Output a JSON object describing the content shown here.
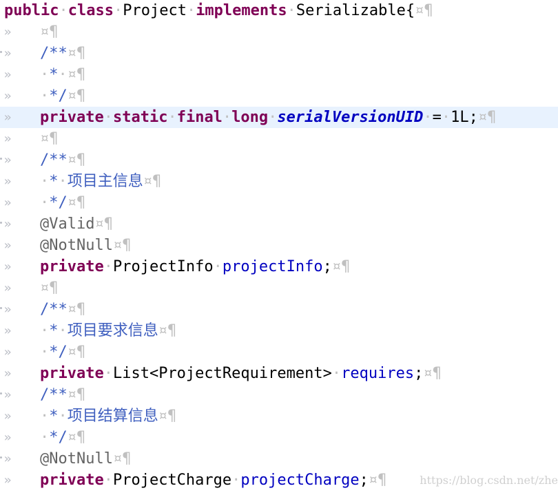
{
  "editor": {
    "lines": [
      {
        "gutter": "",
        "fold": false,
        "indent": false,
        "highlight": false,
        "tokens": [
          [
            "kw",
            "public"
          ],
          [
            "ws",
            "·"
          ],
          [
            "kw",
            "class"
          ],
          [
            "ws",
            "·"
          ],
          [
            "plain",
            "Project"
          ],
          [
            "ws",
            "·"
          ],
          [
            "kw",
            "implements"
          ],
          [
            "ws",
            "·"
          ],
          [
            "plain",
            "Serializable{"
          ],
          [
            "ws",
            "¤¶"
          ]
        ]
      },
      {
        "gutter": "»",
        "fold": false,
        "indent": true,
        "highlight": false,
        "tokens": [
          [
            "ws",
            "¤¶"
          ]
        ]
      },
      {
        "gutter": "»",
        "fold": true,
        "indent": true,
        "highlight": false,
        "tokens": [
          [
            "comment",
            "/**"
          ],
          [
            "ws",
            "¤¶"
          ]
        ]
      },
      {
        "gutter": "»",
        "fold": false,
        "indent": true,
        "highlight": false,
        "tokens": [
          [
            "ws",
            "·"
          ],
          [
            "comment",
            "*"
          ],
          [
            "ws",
            "·¤¶"
          ]
        ]
      },
      {
        "gutter": "»",
        "fold": false,
        "indent": true,
        "highlight": false,
        "tokens": [
          [
            "ws",
            "·"
          ],
          [
            "comment",
            "*/"
          ],
          [
            "ws",
            "¤¶"
          ]
        ]
      },
      {
        "gutter": "»",
        "fold": false,
        "indent": true,
        "highlight": true,
        "tokens": [
          [
            "kw",
            "private"
          ],
          [
            "ws",
            "·"
          ],
          [
            "kw",
            "static"
          ],
          [
            "ws",
            "·"
          ],
          [
            "kw",
            "final"
          ],
          [
            "ws",
            "·"
          ],
          [
            "kw",
            "long"
          ],
          [
            "ws",
            "·"
          ],
          [
            "static-field",
            "serialVersionUID"
          ],
          [
            "ws",
            "·"
          ],
          [
            "plain",
            "="
          ],
          [
            "ws",
            "·"
          ],
          [
            "plain",
            "1L;"
          ],
          [
            "ws",
            "¤¶"
          ]
        ]
      },
      {
        "gutter": "»",
        "fold": false,
        "indent": true,
        "highlight": false,
        "tokens": [
          [
            "ws",
            "¤¶"
          ]
        ]
      },
      {
        "gutter": "»",
        "fold": true,
        "indent": true,
        "highlight": false,
        "tokens": [
          [
            "comment",
            "/**"
          ],
          [
            "ws",
            "¤¶"
          ]
        ]
      },
      {
        "gutter": "»",
        "fold": false,
        "indent": true,
        "highlight": false,
        "tokens": [
          [
            "ws",
            "·"
          ],
          [
            "comment",
            "*"
          ],
          [
            "ws",
            "·"
          ],
          [
            "comment cjk",
            "项目主信息"
          ],
          [
            "ws",
            "¤¶"
          ]
        ]
      },
      {
        "gutter": "»",
        "fold": false,
        "indent": true,
        "highlight": false,
        "tokens": [
          [
            "ws",
            "·"
          ],
          [
            "comment",
            "*/"
          ],
          [
            "ws",
            "¤¶"
          ]
        ]
      },
      {
        "gutter": "»",
        "fold": true,
        "indent": true,
        "highlight": false,
        "tokens": [
          [
            "annotation",
            "@Valid"
          ],
          [
            "ws",
            "¤¶"
          ]
        ]
      },
      {
        "gutter": "»",
        "fold": false,
        "indent": true,
        "highlight": false,
        "tokens": [
          [
            "annotation",
            "@NotNull"
          ],
          [
            "ws",
            "¤¶"
          ]
        ]
      },
      {
        "gutter": "»",
        "fold": false,
        "indent": true,
        "highlight": false,
        "tokens": [
          [
            "kw",
            "private"
          ],
          [
            "ws",
            "·"
          ],
          [
            "plain",
            "ProjectInfo"
          ],
          [
            "ws",
            "·"
          ],
          [
            "field",
            "projectInfo"
          ],
          [
            "plain",
            ";"
          ],
          [
            "ws",
            "¤¶"
          ]
        ]
      },
      {
        "gutter": "»",
        "fold": false,
        "indent": true,
        "highlight": false,
        "tokens": [
          [
            "ws",
            "¤¶"
          ]
        ]
      },
      {
        "gutter": "»",
        "fold": true,
        "indent": true,
        "highlight": false,
        "tokens": [
          [
            "comment",
            "/**"
          ],
          [
            "ws",
            "¤¶"
          ]
        ]
      },
      {
        "gutter": "»",
        "fold": false,
        "indent": true,
        "highlight": false,
        "tokens": [
          [
            "ws",
            "·"
          ],
          [
            "comment",
            "*"
          ],
          [
            "ws",
            "·"
          ],
          [
            "comment cjk",
            "项目要求信息"
          ],
          [
            "ws",
            "¤¶"
          ]
        ]
      },
      {
        "gutter": "»",
        "fold": false,
        "indent": true,
        "highlight": false,
        "tokens": [
          [
            "ws",
            "·"
          ],
          [
            "comment",
            "*/"
          ],
          [
            "ws",
            "¤¶"
          ]
        ]
      },
      {
        "gutter": "»",
        "fold": false,
        "indent": true,
        "highlight": false,
        "tokens": [
          [
            "kw",
            "private"
          ],
          [
            "ws",
            "·"
          ],
          [
            "plain",
            "List<ProjectRequirement>"
          ],
          [
            "ws",
            "·"
          ],
          [
            "field",
            "requires"
          ],
          [
            "plain",
            ";"
          ],
          [
            "ws",
            "¤¶"
          ]
        ]
      },
      {
        "gutter": "»",
        "fold": true,
        "indent": true,
        "highlight": false,
        "tokens": [
          [
            "comment",
            "/**"
          ],
          [
            "ws",
            "¤¶"
          ]
        ]
      },
      {
        "gutter": "»",
        "fold": false,
        "indent": true,
        "highlight": false,
        "tokens": [
          [
            "ws",
            "·"
          ],
          [
            "comment",
            "*"
          ],
          [
            "ws",
            "·"
          ],
          [
            "comment cjk",
            "项目结算信息"
          ],
          [
            "ws",
            "¤¶"
          ]
        ]
      },
      {
        "gutter": "»",
        "fold": false,
        "indent": true,
        "highlight": false,
        "tokens": [
          [
            "ws",
            "·"
          ],
          [
            "comment",
            "*/"
          ],
          [
            "ws",
            "¤¶"
          ]
        ]
      },
      {
        "gutter": "»",
        "fold": true,
        "indent": true,
        "highlight": false,
        "tokens": [
          [
            "annotation",
            "@NotNull"
          ],
          [
            "ws",
            "¤¶"
          ]
        ]
      },
      {
        "gutter": "»",
        "fold": false,
        "indent": true,
        "highlight": false,
        "tokens": [
          [
            "kw",
            "private"
          ],
          [
            "ws",
            "·"
          ],
          [
            "plain",
            "ProjectCharge"
          ],
          [
            "ws",
            "·"
          ],
          [
            "field",
            "projectCharge"
          ],
          [
            "plain",
            ";"
          ],
          [
            "ws",
            "¤¶"
          ]
        ]
      }
    ]
  },
  "watermark": "https://blog.csdn.net/zhe"
}
